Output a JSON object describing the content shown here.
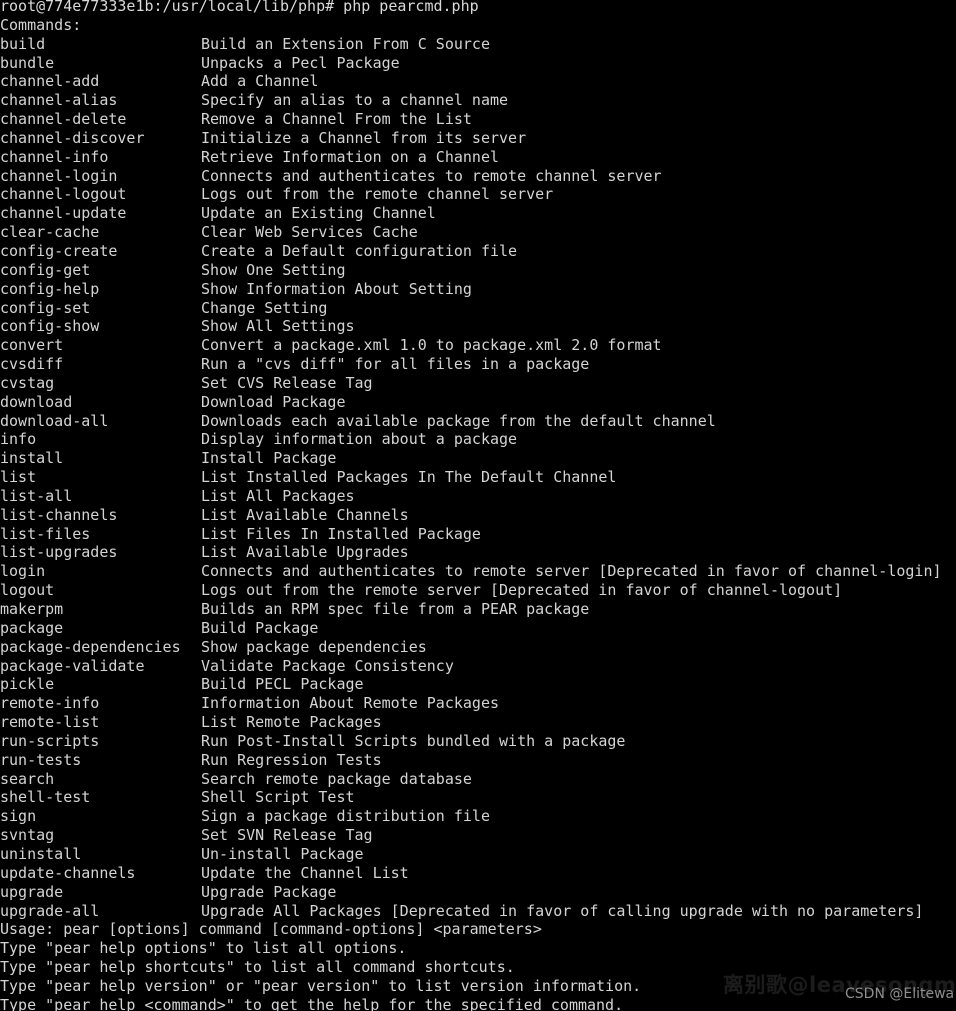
{
  "terminal": {
    "background_color": "#000000",
    "text_color": "#d4d4d4",
    "prompt_line": "root@774e77333e1b:/usr/local/lib/php# php pearcmd.php",
    "commands_header": "Commands:",
    "commands": [
      {
        "name": "build",
        "desc": "Build an Extension From C Source"
      },
      {
        "name": "bundle",
        "desc": "Unpacks a Pecl Package"
      },
      {
        "name": "channel-add",
        "desc": "Add a Channel"
      },
      {
        "name": "channel-alias",
        "desc": "Specify an alias to a channel name"
      },
      {
        "name": "channel-delete",
        "desc": "Remove a Channel From the List"
      },
      {
        "name": "channel-discover",
        "desc": "Initialize a Channel from its server"
      },
      {
        "name": "channel-info",
        "desc": "Retrieve Information on a Channel"
      },
      {
        "name": "channel-login",
        "desc": "Connects and authenticates to remote channel server"
      },
      {
        "name": "channel-logout",
        "desc": "Logs out from the remote channel server"
      },
      {
        "name": "channel-update",
        "desc": "Update an Existing Channel"
      },
      {
        "name": "clear-cache",
        "desc": "Clear Web Services Cache"
      },
      {
        "name": "config-create",
        "desc": "Create a Default configuration file"
      },
      {
        "name": "config-get",
        "desc": "Show One Setting"
      },
      {
        "name": "config-help",
        "desc": "Show Information About Setting"
      },
      {
        "name": "config-set",
        "desc": "Change Setting"
      },
      {
        "name": "config-show",
        "desc": "Show All Settings"
      },
      {
        "name": "convert",
        "desc": "Convert a package.xml 1.0 to package.xml 2.0 format"
      },
      {
        "name": "cvsdiff",
        "desc": "Run a \"cvs diff\" for all files in a package"
      },
      {
        "name": "cvstag",
        "desc": "Set CVS Release Tag"
      },
      {
        "name": "download",
        "desc": "Download Package"
      },
      {
        "name": "download-all",
        "desc": "Downloads each available package from the default channel"
      },
      {
        "name": "info",
        "desc": "Display information about a package"
      },
      {
        "name": "install",
        "desc": "Install Package"
      },
      {
        "name": "list",
        "desc": "List Installed Packages In The Default Channel"
      },
      {
        "name": "list-all",
        "desc": "List All Packages"
      },
      {
        "name": "list-channels",
        "desc": "List Available Channels"
      },
      {
        "name": "list-files",
        "desc": "List Files In Installed Package"
      },
      {
        "name": "list-upgrades",
        "desc": "List Available Upgrades"
      },
      {
        "name": "login",
        "desc": "Connects and authenticates to remote server [Deprecated in favor of channel-login]"
      },
      {
        "name": "logout",
        "desc": "Logs out from the remote server [Deprecated in favor of channel-logout]"
      },
      {
        "name": "makerpm",
        "desc": "Builds an RPM spec file from a PEAR package"
      },
      {
        "name": "package",
        "desc": "Build Package"
      },
      {
        "name": "package-dependencies",
        "desc": "Show package dependencies"
      },
      {
        "name": "package-validate",
        "desc": "Validate Package Consistency"
      },
      {
        "name": "pickle",
        "desc": "Build PECL Package"
      },
      {
        "name": "remote-info",
        "desc": "Information About Remote Packages"
      },
      {
        "name": "remote-list",
        "desc": "List Remote Packages"
      },
      {
        "name": "run-scripts",
        "desc": "Run Post-Install Scripts bundled with a package"
      },
      {
        "name": "run-tests",
        "desc": "Run Regression Tests"
      },
      {
        "name": "search",
        "desc": "Search remote package database"
      },
      {
        "name": "shell-test",
        "desc": "Shell Script Test"
      },
      {
        "name": "sign",
        "desc": "Sign a package distribution file"
      },
      {
        "name": "svntag",
        "desc": "Set SVN Release Tag"
      },
      {
        "name": "uninstall",
        "desc": "Un-install Package"
      },
      {
        "name": "update-channels",
        "desc": "Update the Channel List"
      },
      {
        "name": "upgrade",
        "desc": "Upgrade Package"
      },
      {
        "name": "upgrade-all",
        "desc": "Upgrade All Packages [Deprecated in favor of calling upgrade with no parameters]"
      }
    ],
    "footer_lines": [
      "Usage: pear [options] command [command-options] <parameters>",
      "Type \"pear help options\" to list all options.",
      "Type \"pear help shortcuts\" to list all command shortcuts.",
      "Type \"pear help version\" or \"pear version\" to list version information.",
      "Type \"pear help <command>\" to get the help for the specified command."
    ]
  },
  "watermarks": {
    "cjk": "离别歌@leavesongm",
    "cjk_color": "#1c1c1c",
    "csdn": "CSDN @Elitewa",
    "csdn_color": "#8e8e8e"
  }
}
